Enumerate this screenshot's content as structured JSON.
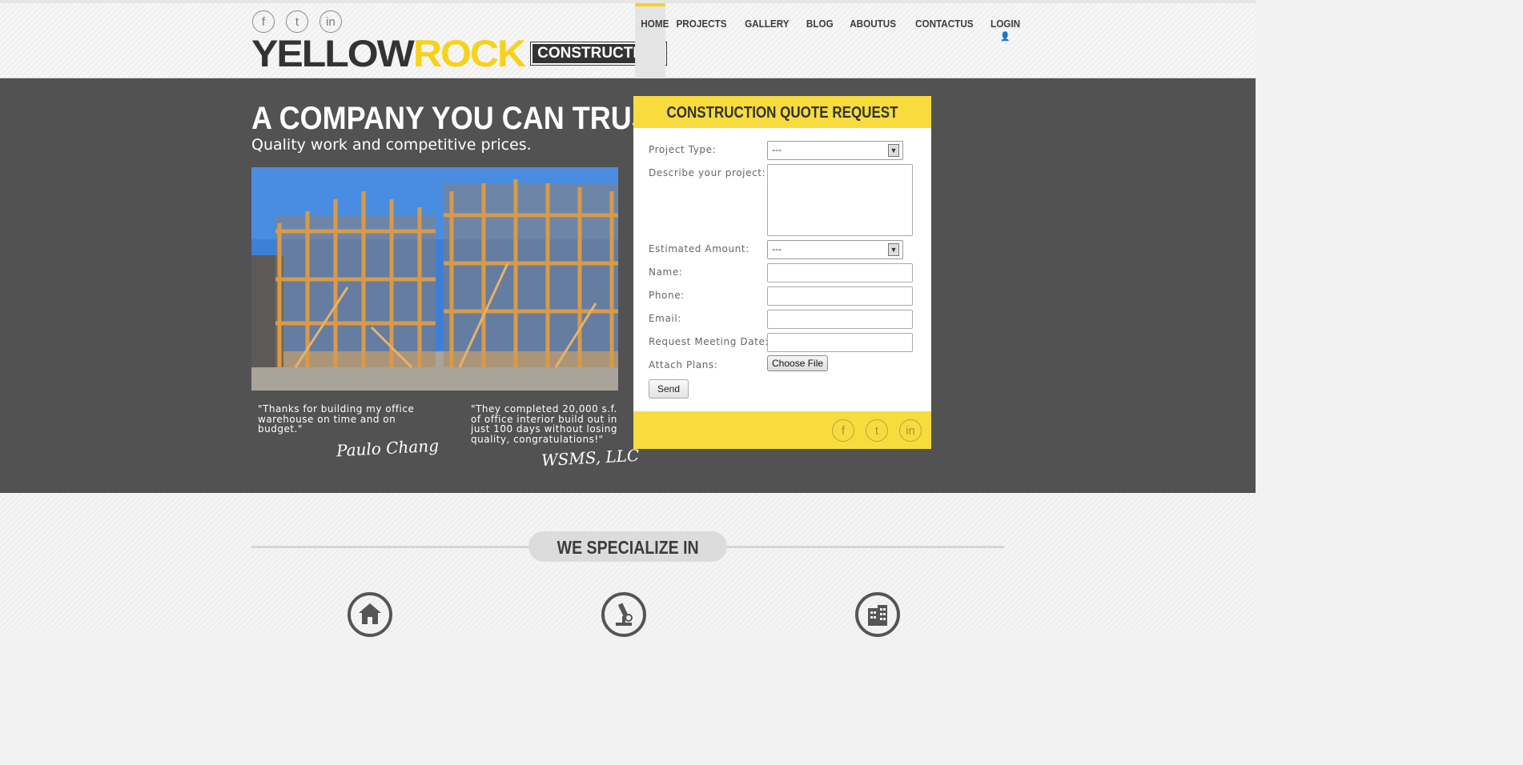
{
  "header": {
    "social": [
      "f",
      "t",
      "in"
    ],
    "logo": {
      "part1": "YELLOW",
      "part2": "ROCK",
      "tag": "CONSTRUCTION"
    },
    "nav": [
      "HOME",
      "PROJECTS",
      "GALLERY",
      "BLOG",
      "ABOUTUS",
      "CONTACTUS",
      "LOGIN"
    ]
  },
  "hero": {
    "title": "A COMPANY YOU CAN TRUST",
    "subtitle": "Quality work and competitive prices.",
    "quotes": [
      {
        "text": "\"Thanks for building my office warehouse on time and on budget.\"",
        "author": "Paulo Chang"
      },
      {
        "text": "\"They completed 20,000 s.f. of office interior build out in just 100 days without losing quality, congratulations!\"",
        "author": "WSMS, LLC"
      }
    ]
  },
  "form": {
    "title": "CONSTRUCTION QUOTE REQUEST",
    "labels": {
      "project_type": "Project Type:",
      "describe": "Describe your project:",
      "amount": "Estimated Amount:",
      "name": "Name:",
      "phone": "Phone:",
      "email": "Email:",
      "meeting": "Request Meeting Date:",
      "attach": "Attach Plans:"
    },
    "project_type_value": "---",
    "amount_value": "---",
    "file_button": "Choose File",
    "send": "Send",
    "footer_social": [
      "f",
      "t",
      "in"
    ]
  },
  "specialize": {
    "title": "WE SPECIALIZE IN"
  },
  "colors": {
    "accent": "#f8dc3e",
    "dark": "#525252"
  }
}
